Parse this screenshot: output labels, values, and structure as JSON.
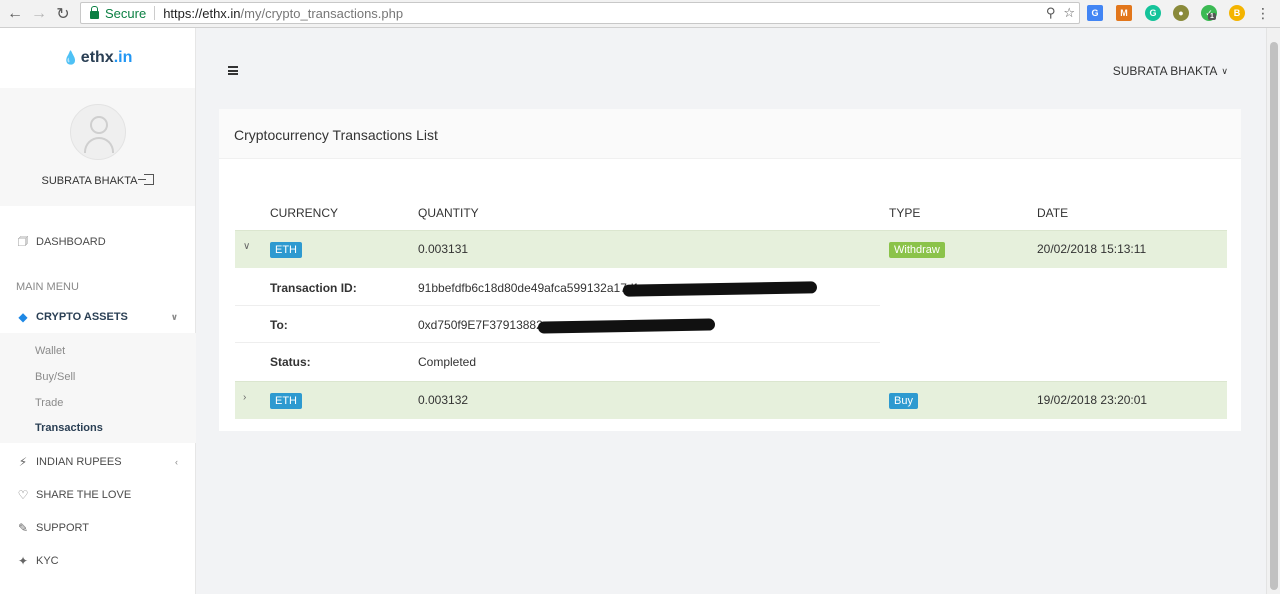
{
  "browser": {
    "secure_label": "Secure",
    "url_host": "https://ethx.in",
    "url_path": "/my/crypto_transactions.php",
    "extension_badge": "1"
  },
  "brand": {
    "name": "ethx",
    "tld": ".in"
  },
  "profile": {
    "name": "SUBRATA BHAKTA"
  },
  "sidebar": {
    "dashboard": "DASHBOARD",
    "menu_header": "MAIN MENU",
    "crypto_assets": "CRYPTO ASSETS",
    "submenu": [
      "Wallet",
      "Buy/Sell",
      "Trade",
      "Transactions"
    ],
    "indian_rupees": "INDIAN RUPEES",
    "share_the_love": "SHARE THE LOVE",
    "support": "SUPPORT",
    "kyc": "KYC"
  },
  "header": {
    "user_name": "SUBRATA BHAKTA"
  },
  "panel": {
    "title": "Cryptocurrency Transactions List"
  },
  "table": {
    "columns": [
      "CURRENCY",
      "QUANTITY",
      "TYPE",
      "DATE"
    ],
    "rows": [
      {
        "currency": "ETH",
        "quantity": "0.003131",
        "type": "Withdraw",
        "date": "20/02/2018 15:13:11",
        "expanded": true
      },
      {
        "currency": "ETH",
        "quantity": "0.003132",
        "type": "Buy",
        "date": "19/02/2018 23:20:01",
        "expanded": false
      }
    ],
    "details": {
      "transaction_id_label": "Transaction ID:",
      "transaction_id_value": "91bbefdfb6c18d80de49afca599132a17dfe",
      "to_label": "To:",
      "to_value": "0xd750f9E7F37913882",
      "status_label": "Status:",
      "status_value": "Completed"
    }
  },
  "colors": {
    "accent_blue": "#2e9ad0",
    "withdraw_green": "#8bc34a",
    "row_highlight": "#e6f0dc",
    "secure_green": "#0b8043"
  }
}
